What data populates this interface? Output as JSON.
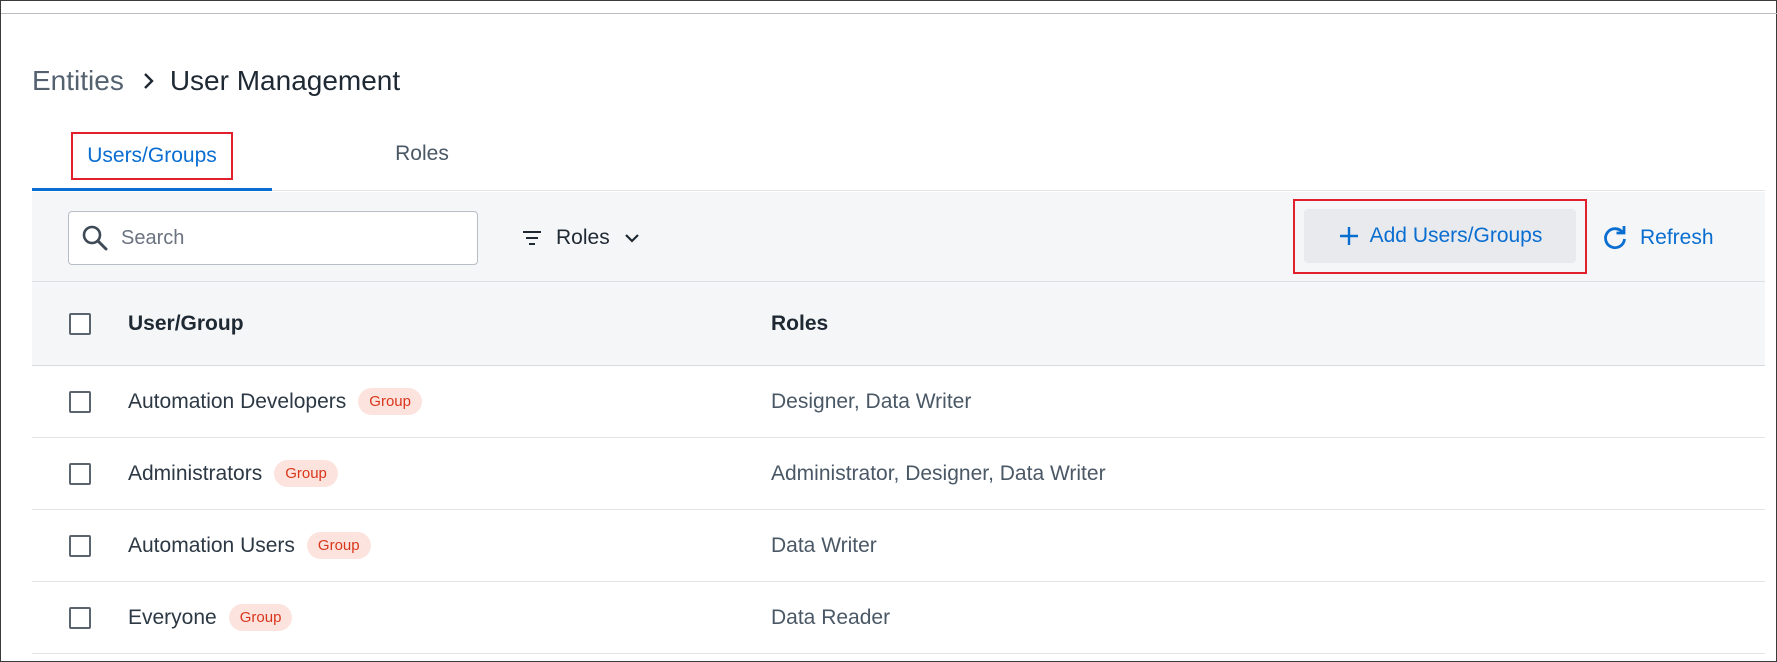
{
  "breadcrumb": {
    "parent": "Entities",
    "current": "User Management"
  },
  "tabs": [
    {
      "label": "Users/Groups",
      "active": true
    },
    {
      "label": "Roles",
      "active": false
    }
  ],
  "toolbar": {
    "search_placeholder": "Search",
    "roles_filter_label": "Roles",
    "add_label": "Add Users/Groups",
    "refresh_label": "Refresh"
  },
  "table": {
    "headers": {
      "name": "User/Group",
      "roles": "Roles"
    },
    "rows": [
      {
        "name": "Automation Developers",
        "badge": "Group",
        "roles": "Designer, Data Writer"
      },
      {
        "name": "Administrators",
        "badge": "Group",
        "roles": "Administrator, Designer, Data Writer"
      },
      {
        "name": "Automation Users",
        "badge": "Group",
        "roles": "Data Writer"
      },
      {
        "name": "Everyone",
        "badge": "Group",
        "roles": "Data Reader"
      }
    ]
  },
  "colors": {
    "accent": "#0a6ed1",
    "highlight_border": "#e0202a",
    "badge_bg": "#fde3de",
    "badge_text": "#d9361b"
  },
  "icons": [
    "chevron-right-icon",
    "search-icon",
    "filter-icon",
    "chevron-down-icon",
    "plus-icon",
    "refresh-icon"
  ]
}
